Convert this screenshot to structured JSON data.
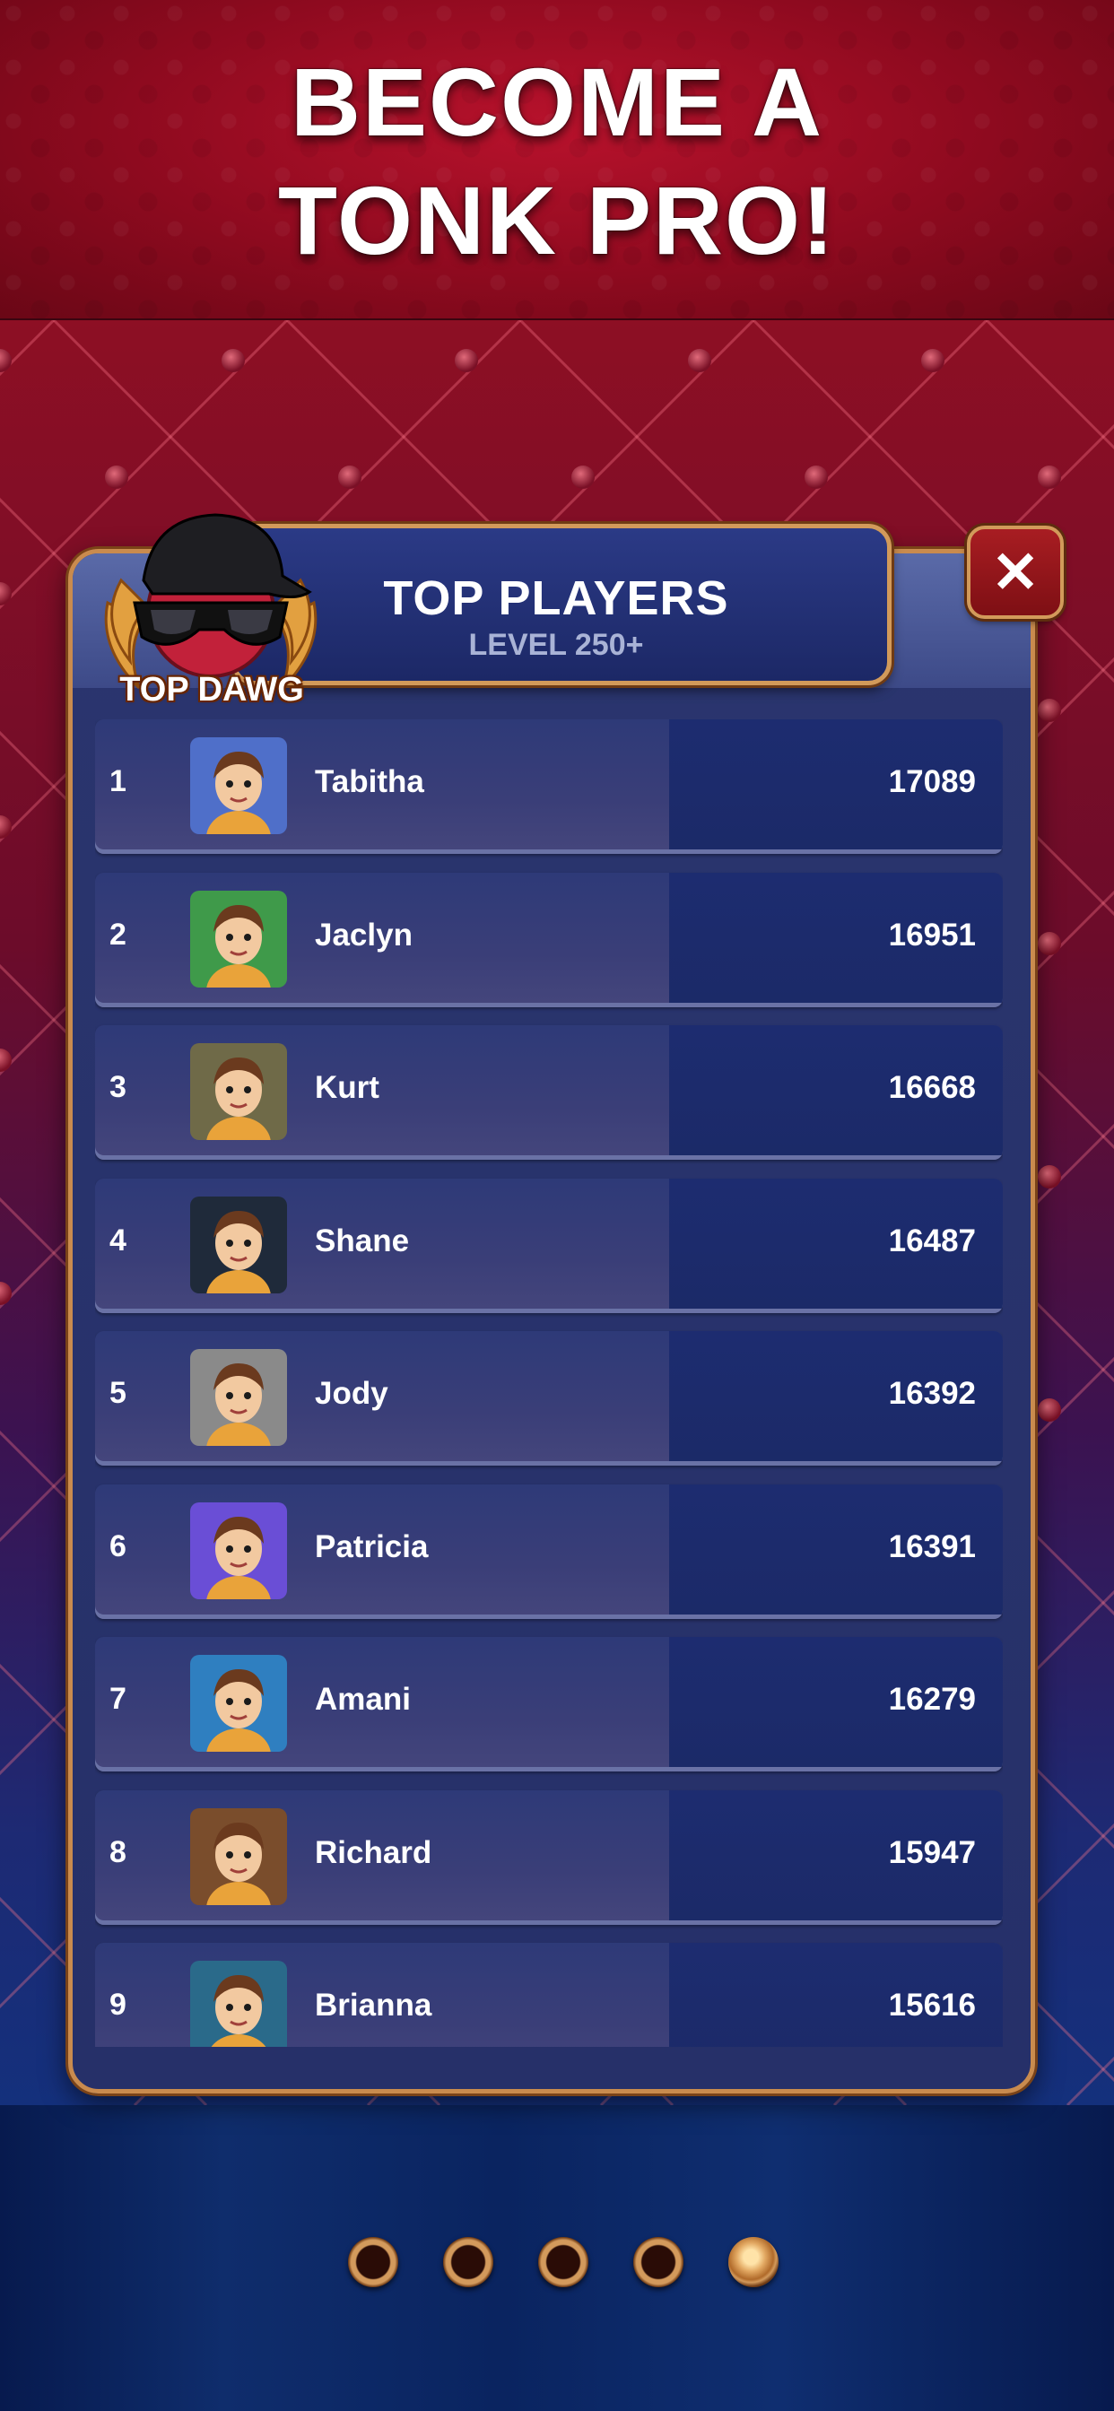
{
  "banner": {
    "line1": "BECOME A",
    "line2": "TONK PRO!"
  },
  "dialog": {
    "title": "TOP PLAYERS",
    "subtitle": "LEVEL 250+",
    "badge_label": "TOP DAWG",
    "close_icon": "close-icon"
  },
  "leaderboard": [
    {
      "rank": "1",
      "name": "Tabitha",
      "score": "17089",
      "avatar_bg": "#4f6fc9"
    },
    {
      "rank": "2",
      "name": "Jaclyn",
      "score": "16951",
      "avatar_bg": "#3f9a4a"
    },
    {
      "rank": "3",
      "name": "Kurt",
      "score": "16668",
      "avatar_bg": "#6f6a48"
    },
    {
      "rank": "4",
      "name": "Shane",
      "score": "16487",
      "avatar_bg": "#1f2a3a"
    },
    {
      "rank": "5",
      "name": "Jody",
      "score": "16392",
      "avatar_bg": "#8a8a8a"
    },
    {
      "rank": "6",
      "name": "Patricia",
      "score": "16391",
      "avatar_bg": "#6a4ed6"
    },
    {
      "rank": "7",
      "name": "Amani",
      "score": "16279",
      "avatar_bg": "#2f7fc0"
    },
    {
      "rank": "8",
      "name": "Richard",
      "score": "15947",
      "avatar_bg": "#7a4d2c"
    },
    {
      "rank": "9",
      "name": "Brianna",
      "score": "15616",
      "avatar_bg": "#2a6a8a"
    }
  ],
  "pagination": {
    "count": 5,
    "active_index": 4
  },
  "colors": {
    "banner_red": "#a3102a",
    "gold_border": "#c98b4e",
    "row_bg": "#2e3a78",
    "score_panel": "#1d2c70"
  }
}
